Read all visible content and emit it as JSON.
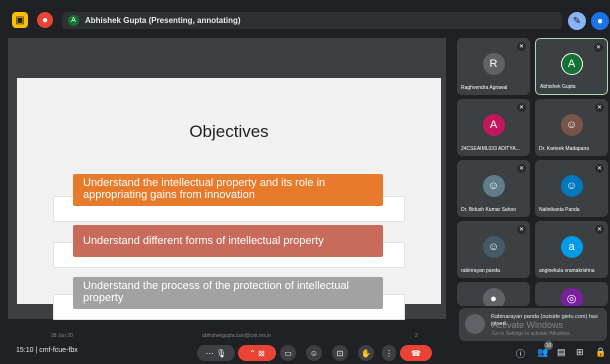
{
  "topbar": {
    "presenter_initial": "A",
    "presenter_text": "Abhishek Gupta (Presenting, annotating)"
  },
  "slide": {
    "title": "Objectives",
    "bullets": [
      "Understand the intellectual property and its role in appropriating gains from innovation",
      "Understand different forms of intellectual property",
      "Understand the process of the protection of intellectual property"
    ],
    "footer_left": "28 Jun 20",
    "footer_center": "abhishekgupta.csio@csir.res.in",
    "footer_right": "2"
  },
  "participants": [
    {
      "name": "Raghvendra Agrawal",
      "initial": "R",
      "avatar_color": "#5f6368"
    },
    {
      "name": "Abhishek Gupta",
      "initial": "A",
      "avatar_color": "#137333"
    },
    {
      "name": "24CSEAIML033 ADITYA...",
      "initial": "A",
      "avatar_color": "#c2185b"
    },
    {
      "name": "Dr. Karteek Madapana",
      "initial": "",
      "avatar_color": "#795548"
    },
    {
      "name": "Dr. Bidush Kumar Sahoo",
      "initial": "",
      "avatar_color": "#607d8b"
    },
    {
      "name": "Nalinikanta Panda",
      "initial": "",
      "avatar_color": "#0277bd"
    },
    {
      "name": "rabinrayan panda",
      "initial": "",
      "avatar_color": "#455a64"
    },
    {
      "name": "anginekula vramakrishna",
      "initial": "a",
      "avatar_color": "#039be5"
    }
  ],
  "notification": {
    "text": "Rabinarayan panda (outside gietu.com) has joined"
  },
  "watermark": {
    "line1": "Activate Windows",
    "line2": "Go to Settings to activate Windows."
  },
  "bottombar": {
    "time_and_code": "15:10  |  cmf-fcue-fbx",
    "participant_count": "10"
  }
}
